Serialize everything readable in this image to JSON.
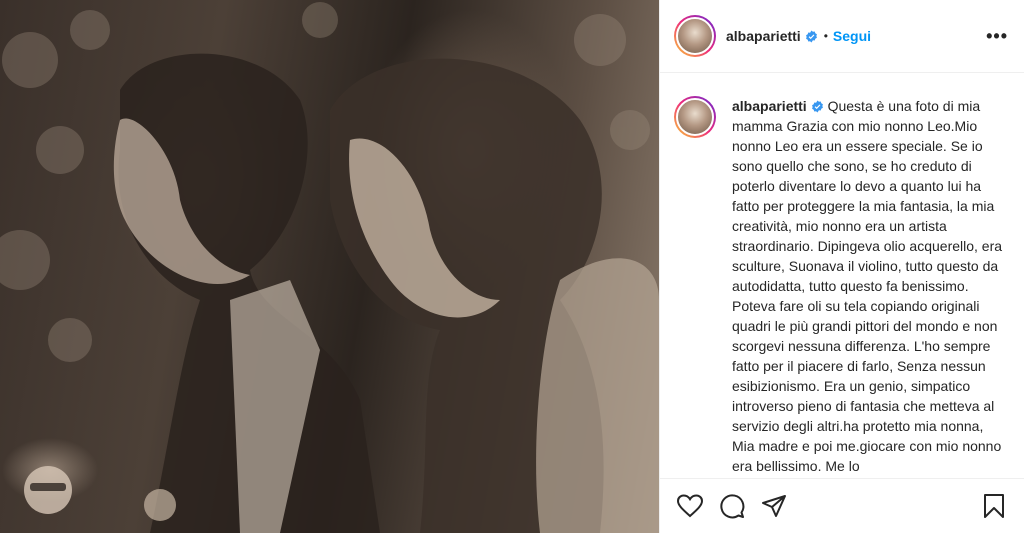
{
  "post": {
    "username": "albaparietti",
    "follow_label": "Segui",
    "separator": "•",
    "more_label": "•••",
    "caption": "Questa è una foto di mia mamma Grazia con mio nonno Leo.Mio nonno Leo era un essere speciale. Se io sono quello che sono, se ho creduto di poterlo diventare lo devo a quanto lui ha fatto per proteggere la mia fantasia, la mia creatività, mio nonno era un artista straordinario. Dipingeva olio acquerello, era sculture, Suonava il violino, tutto questo da autodidatta, tutto questo fa benissimo. Poteva fare oli su tela copiando originali quadri le più grandi pittori del mondo e non scorgevi nessuna differenza. L'ho sempre fatto per il piacere di farlo, Senza nessun esibizionismo. Era un genio, simpatico introverso pieno di fantasia che metteva al servizio degli altri.ha protetto mia nonna, Mia madre e poi me.giocare con mio nonno era bellissimo. Me lo"
  },
  "icons": {
    "verified": "verified-badge-icon",
    "like": "heart-icon",
    "comment": "comment-icon",
    "share": "paper-plane-icon",
    "save": "bookmark-icon"
  },
  "colors": {
    "accent": "#0095f6",
    "text": "#262626",
    "border": "#efefef"
  }
}
